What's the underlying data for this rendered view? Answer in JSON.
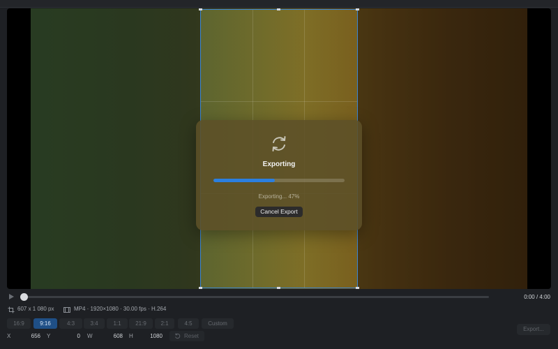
{
  "viewer": {
    "colors": {
      "crop_border": "#3b86d6",
      "progress_fill": "#2b7fe0",
      "selected_ratio": "#1f4f86"
    }
  },
  "export_modal": {
    "icon": "refresh-icon",
    "title": "Exporting",
    "progress_fraction": 0.47,
    "status_text": "Exporting... 47%",
    "cancel_label": "Cancel Export"
  },
  "timeline": {
    "play_icon": "play-icon",
    "timecode": "0:00 / 4:00",
    "position_fraction": 0.0
  },
  "info": {
    "crop_size": "607 x 1 080 px",
    "format": "MP4 · 1920×1080 · 30.00 fps · H.264",
    "crop_icon": "crop-icon",
    "film_icon": "film-icon"
  },
  "ratios": {
    "items": [
      "16:9",
      "9:16",
      "4:3",
      "3:4",
      "1:1",
      "21:9",
      "2:1",
      "4:5",
      "Custom"
    ],
    "selected": "9:16"
  },
  "coordinates": {
    "x_label": "X",
    "x_value": "656",
    "y_label": "Y",
    "y_value": "0",
    "w_label": "W",
    "w_value": "608",
    "h_label": "H",
    "h_value": "1080"
  },
  "actions": {
    "reset_label": "Reset",
    "reset_icon": "reset-icon",
    "export_label": "Export..."
  }
}
